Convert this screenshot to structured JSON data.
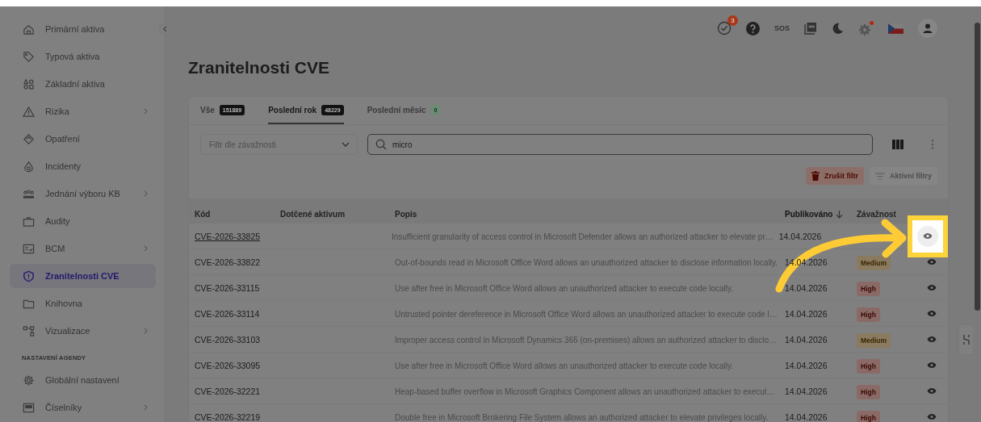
{
  "sidebar": {
    "items": [
      {
        "label": "Primární aktiva",
        "submenu": false,
        "selected": false
      },
      {
        "label": "Typová aktiva",
        "submenu": false,
        "selected": false
      },
      {
        "label": "Základní aktiva",
        "submenu": false,
        "selected": false
      },
      {
        "label": "Rizika",
        "submenu": true,
        "selected": false
      },
      {
        "label": "Opatření",
        "submenu": false,
        "selected": false
      },
      {
        "label": "Incidenty",
        "submenu": false,
        "selected": false
      },
      {
        "label": "Jednání výboru KB",
        "submenu": true,
        "selected": false
      },
      {
        "label": "Audity",
        "submenu": false,
        "selected": false
      },
      {
        "label": "BCM",
        "submenu": true,
        "selected": false
      },
      {
        "label": "Zranitelnosti CVE",
        "submenu": false,
        "selected": true
      },
      {
        "label": "Knihovna",
        "submenu": false,
        "selected": false
      },
      {
        "label": "Vizualizace",
        "submenu": true,
        "selected": false
      }
    ],
    "section_title": "NASTAVENÍ AGENDY",
    "section_items": [
      {
        "label": "Globální nastavení",
        "submenu": false,
        "selected": false
      },
      {
        "label": "Číselníky",
        "submenu": true,
        "selected": false
      }
    ]
  },
  "toolbar": [
    {
      "kind": "tasks",
      "badge": "3"
    },
    {
      "kind": "help"
    },
    {
      "kind": "text",
      "label": "SOS"
    },
    {
      "kind": "pdf"
    },
    {
      "kind": "moon"
    },
    {
      "kind": "gear",
      "alert": true
    },
    {
      "kind": "flag"
    },
    {
      "kind": "avatar"
    }
  ],
  "page_title": "Zranitelnosti CVE",
  "tabs": [
    {
      "label": "Vše",
      "count": "151889",
      "kind": "dark",
      "selected": false
    },
    {
      "label": "Poslední rok",
      "count": "48229",
      "kind": "dark",
      "selected": true
    },
    {
      "label": "Poslední měsíc",
      "count": "0",
      "kind": "success",
      "selected": false
    }
  ],
  "severity_filter": {
    "placeholder": "Filtr dle závažnosti"
  },
  "search": {
    "value": "micro"
  },
  "filter_buttons": [
    {
      "kind": "clear",
      "label": "Zrušit filtr",
      "disabled": false
    },
    {
      "kind": "active",
      "label": "Aktivní filtry",
      "disabled": true
    }
  ],
  "table": {
    "columns": [
      {
        "label": "Kód",
        "sorted": false
      },
      {
        "label": "Dotčené aktivum",
        "sorted": false
      },
      {
        "label": "Popis",
        "sorted": false
      },
      {
        "label": "Publikováno",
        "sorted": true
      },
      {
        "label": "Závažnost",
        "sorted": false
      }
    ],
    "rows": [
      {
        "code": "CVE-2026-33825",
        "description": "Insufficient granularity of access control in Microsoft Defender allows an authorized attacker to elevate pr…",
        "published": "14.04.2026",
        "hovered": true,
        "highlighted": true
      },
      {
        "code": "CVE-2026-33822",
        "description": "Out-of-bounds read in Microsoft Office Word allows an unauthorized attacker to disclose information locally.",
        "published": "14.04.2026",
        "severity": "Medium",
        "kind": "medium",
        "hovered": false,
        "highlighted": false
      },
      {
        "code": "CVE-2026-33115",
        "description": "Use after free in Microsoft Office Word allows an unauthorized attacker to execute code locally.",
        "published": "14.04.2026",
        "severity": "High",
        "kind": "high",
        "hovered": false,
        "highlighted": false
      },
      {
        "code": "CVE-2026-33114",
        "description": "Untrusted pointer dereference in Microsoft Office Word allows an unauthorized attacker to execute code l…",
        "published": "14.04.2026",
        "severity": "High",
        "kind": "high",
        "hovered": false,
        "highlighted": false
      },
      {
        "code": "CVE-2026-33103",
        "description": "Improper access control in Microsoft Dynamics 365 (on-premises) allows an authorized attacker to disclo…",
        "published": "14.04.2026",
        "severity": "Medium",
        "kind": "medium",
        "hovered": false,
        "highlighted": false
      },
      {
        "code": "CVE-2026-33095",
        "description": "Use after free in Microsoft Office Word allows an unauthorized attacker to execute code locally.",
        "published": "14.04.2026",
        "severity": "High",
        "kind": "high",
        "hovered": false,
        "highlighted": false
      },
      {
        "code": "CVE-2026-32221",
        "description": "Heap-based buffer overflow in Microsoft Graphics Component allows an unauthorized attacker to execut…",
        "published": "14.04.2026",
        "severity": "High",
        "kind": "high",
        "hovered": false,
        "highlighted": false
      },
      {
        "code": "CVE-2026-32219",
        "description": "Double free in Microsoft Brokering File System allows an authorized attacker to elevate privileges locally.",
        "published": "14.04.2026",
        "severity": "High",
        "kind": "high",
        "hovered": false,
        "highlighted": false
      }
    ]
  },
  "annotation": {
    "arrow": true
  }
}
